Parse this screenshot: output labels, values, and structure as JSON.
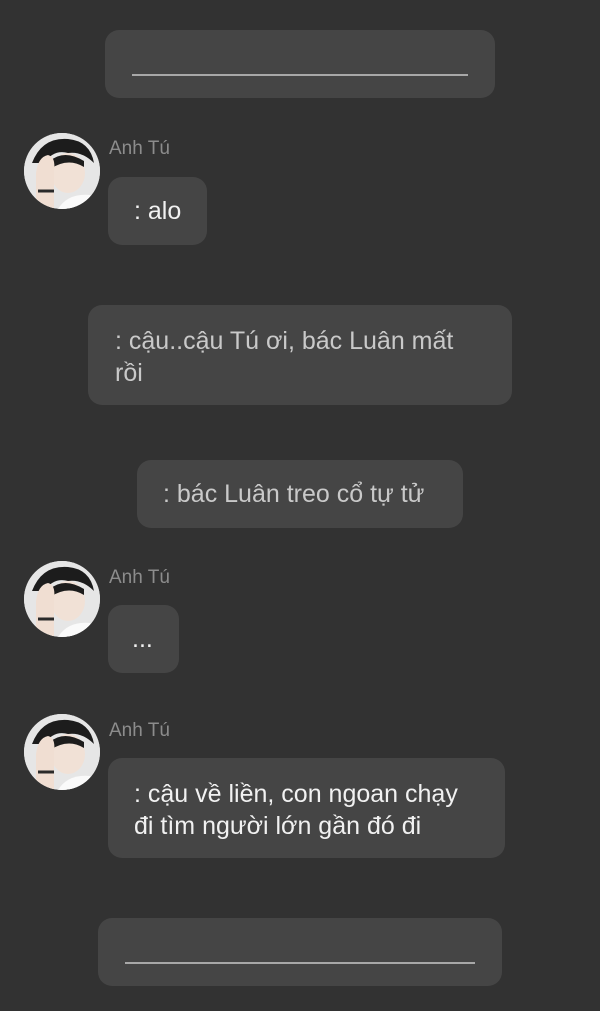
{
  "conversation": {
    "messages": [
      {
        "type": "divider"
      },
      {
        "type": "incoming",
        "sender": "Anh Tú",
        "text": ": alo",
        "avatar": "person-photo-icon"
      },
      {
        "type": "center",
        "text": ": cậu..cậu Tú ơi, bác Luân mất rồi"
      },
      {
        "type": "center",
        "text": ": bác Luân treo cổ tự tử"
      },
      {
        "type": "incoming",
        "sender": "Anh Tú",
        "text": "...",
        "avatar": "person-photo-icon"
      },
      {
        "type": "incoming",
        "sender": "Anh Tú",
        "text": ": cậu về liền, con ngoan chạy đi tìm người lớn gần đó đi",
        "avatar": "person-photo-icon"
      },
      {
        "type": "divider"
      }
    ]
  },
  "colors": {
    "background": "#323232",
    "bubble": "#454545",
    "sender_name": "#8c8c8c",
    "divider_line": "#a8a8a8"
  }
}
